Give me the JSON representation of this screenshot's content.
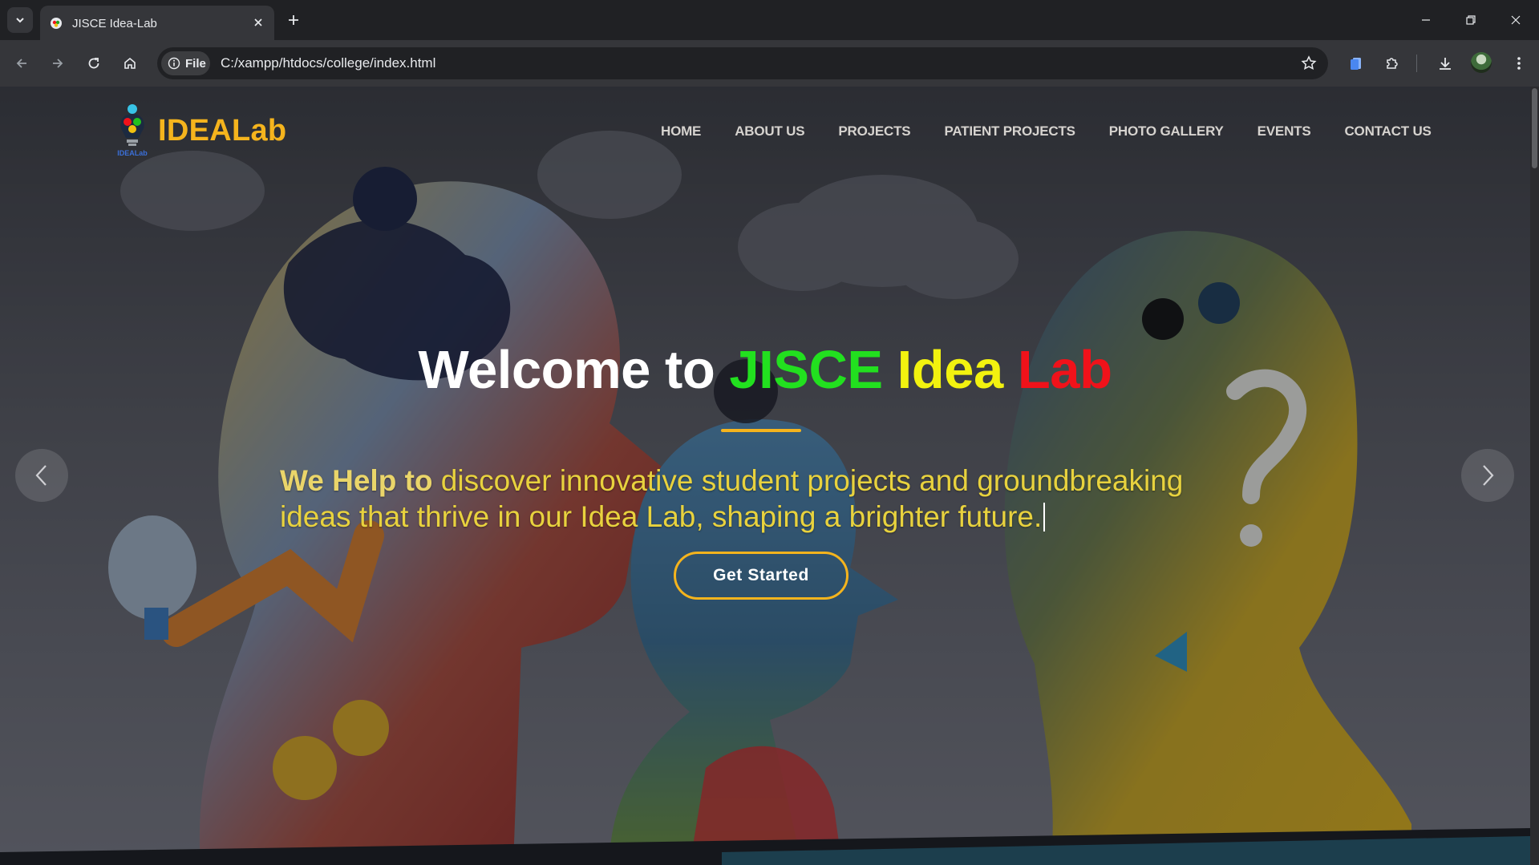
{
  "browser": {
    "tab_title": "JISCE Idea-Lab",
    "url": "C:/xampp/htdocs/college/index.html",
    "site_info_label": "File"
  },
  "site": {
    "logo_text": "IDEALab",
    "logo_badge": "IDEALab",
    "nav": [
      "HOME",
      "ABOUT US",
      "PROJECTS",
      "PATIENT PROJECTS",
      "PHOTO GALLERY",
      "EVENTS",
      "CONTACT US"
    ]
  },
  "hero": {
    "headline_prefix": "Welcome to ",
    "headline_word1": "JISCE",
    "headline_word2": "Idea",
    "headline_word3": "Lab",
    "subtitle_lead": "We Help to",
    "subtitle_rest": " discover innovative student projects and groundbreaking ideas that thrive in our Idea Lab, shaping a brighter future.",
    "cta_label": "Get Started"
  },
  "colors": {
    "accent": "#f5b41d",
    "jisce": "#22e01f",
    "idea": "#f2f20f",
    "lab": "#f0121a"
  }
}
